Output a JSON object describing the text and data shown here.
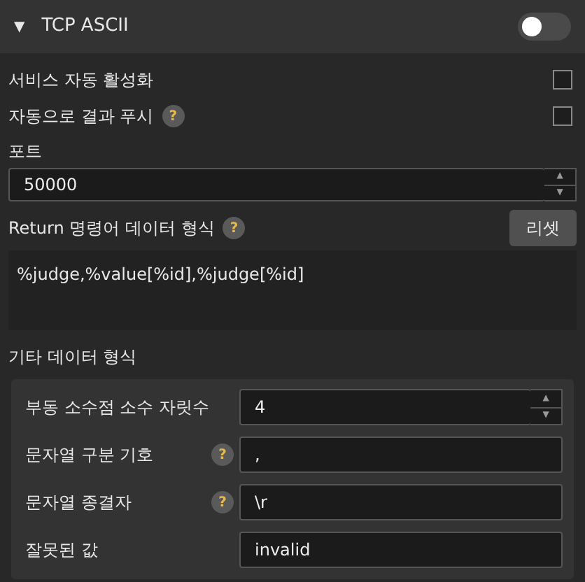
{
  "header": {
    "arrow": "▼",
    "title": "TCP ASCII",
    "enabled": false
  },
  "checks": [
    {
      "label": "서비스 자동 활성화",
      "checked": false
    },
    {
      "label": "자동으로 결과 푸시",
      "help": "?",
      "checked": false
    }
  ],
  "port": {
    "label": "포트",
    "value": "50000",
    "arrows": [
      "▲",
      "▼"
    ]
  },
  "return_format": {
    "label": "Return 명령어 데이터 형식",
    "help": "?",
    "reset": "리셋",
    "value": "%judge,%value[%id],%judge[%id]"
  },
  "other": {
    "title": "기타 데이터 형식",
    "rows": [
      {
        "kind": "spin",
        "label": "부동 소수점 소수 자릿수",
        "value": "4",
        "arrows": [
          "▲",
          "▼"
        ]
      },
      {
        "kind": "text",
        "label": "문자열 구분 기호",
        "help": "?",
        "value": ","
      },
      {
        "kind": "text",
        "label": "문자열 종결자",
        "help": "?",
        "value": "\\r"
      },
      {
        "kind": "text",
        "label": "잘못된 값",
        "value": "invalid"
      }
    ]
  }
}
